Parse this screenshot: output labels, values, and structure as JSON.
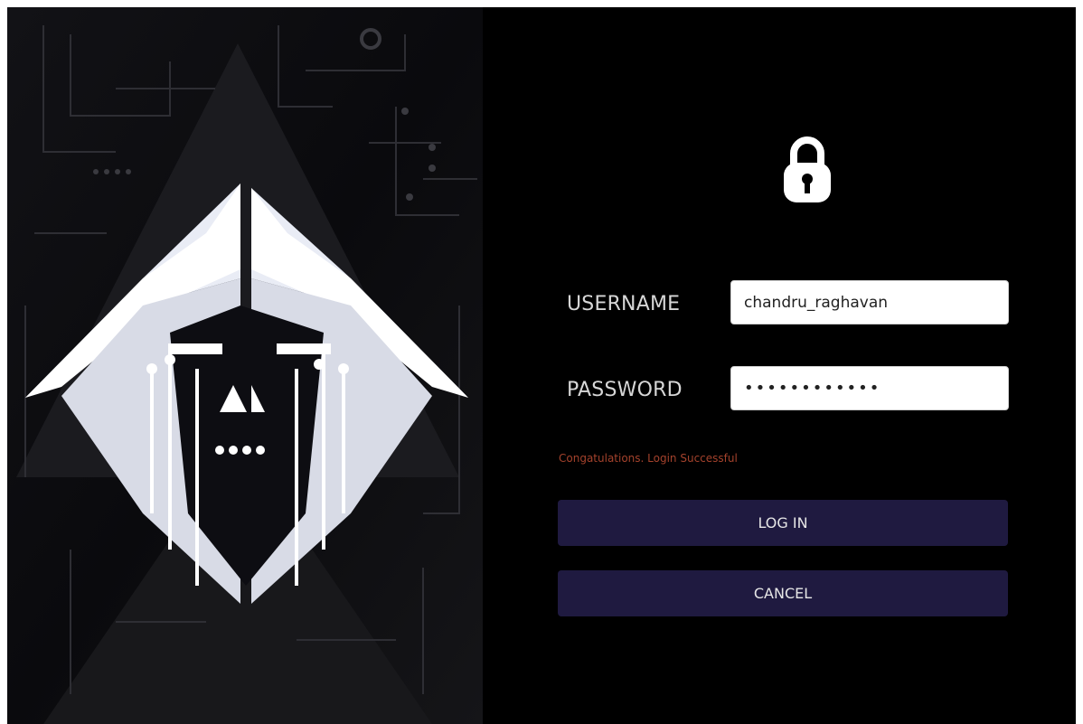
{
  "form": {
    "username_label": "USERNAME",
    "username_value": "chandru_raghavan",
    "password_label": "PASSWORD",
    "password_value": "••••••••••••",
    "status_message": "Congatulations. Login Successful",
    "login_label": "LOG IN",
    "cancel_label": "CANCEL"
  },
  "icons": {
    "lock": "lock-icon",
    "logo": "cyber-diamond-logo"
  },
  "colors": {
    "background": "#000000",
    "button": "#1f1a40",
    "status_text": "#a4422c",
    "label_text": "#d7d7d7"
  }
}
